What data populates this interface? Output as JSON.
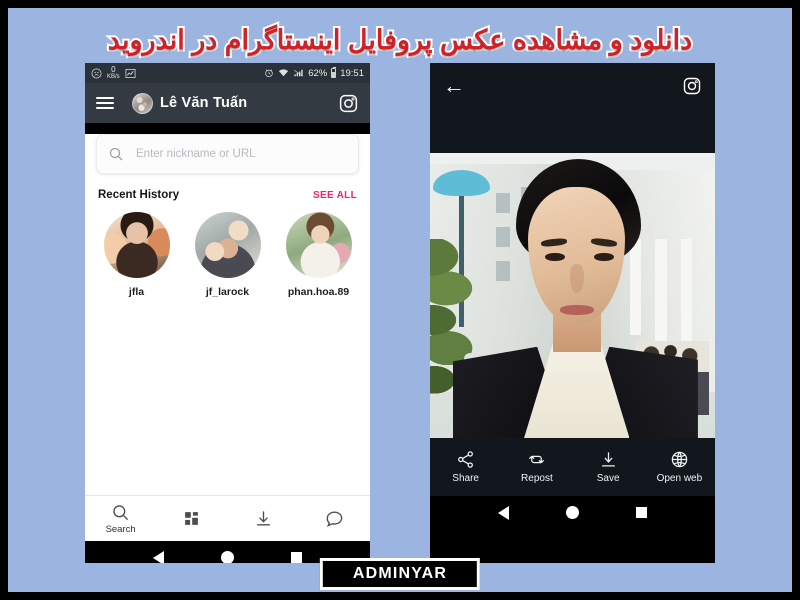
{
  "page": {
    "title_fa": "دانلود و مشاهده عکس پروفایل اینستاگرام در اندروید",
    "title_color": "#d02028",
    "background_color": "#9cb4e0",
    "footer_watermark": "ADMINYAR"
  },
  "left_phone": {
    "statusbar": {
      "data_rate": "0",
      "data_unit": "KB/s",
      "battery_percent": "62%",
      "clock": "19:51",
      "icons": [
        "face-icon",
        "data-usage-icon",
        "chart-icon",
        "alarm-icon",
        "wifi-icon",
        "signal-icon",
        "battery-icon"
      ]
    },
    "appbar": {
      "menu_icon": "hamburger-menu-icon",
      "profile_name": "Lê Văn Tuấn",
      "right_icon": "instagram-icon"
    },
    "search": {
      "icon": "search-icon",
      "value": "",
      "placeholder": "Enter nickname or URL"
    },
    "recent_history": {
      "heading": "Recent History",
      "see_all_label": "SEE ALL",
      "see_all_color": "#f0246c",
      "items": [
        {
          "username": "jfla"
        },
        {
          "username": "jf_larock"
        },
        {
          "username": "phan.hoa.89"
        }
      ]
    },
    "bottom_nav": [
      {
        "label": "Search",
        "icon": "search-icon",
        "active": true
      },
      {
        "label": "",
        "icon": "grid-icon",
        "active": false
      },
      {
        "label": "",
        "icon": "download-icon",
        "active": false
      },
      {
        "label": "",
        "icon": "chat-bubble-icon",
        "active": false
      }
    ]
  },
  "right_phone": {
    "topbar": {
      "back_icon": "back-arrow-icon",
      "right_icon": "instagram-icon"
    },
    "photo": {
      "description": "Profile photo of a young man in a dark suit and white shirt in front of a light-colored building with a palm tree"
    },
    "actions": [
      {
        "label": "Share",
        "icon": "share-icon"
      },
      {
        "label": "Repost",
        "icon": "repost-icon"
      },
      {
        "label": "Save",
        "icon": "download-icon"
      },
      {
        "label": "Open web",
        "icon": "globe-icon"
      }
    ]
  },
  "android_nav": {
    "back": "back-triangle-icon",
    "home": "home-circle-icon",
    "recents": "recents-square-icon"
  }
}
